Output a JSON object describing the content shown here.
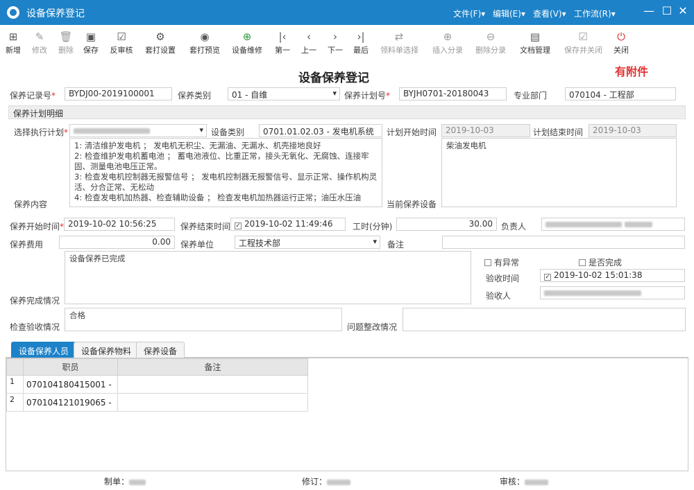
{
  "window": {
    "title": "设备保养登记",
    "menus": [
      "文件(F)▾",
      "编辑(E)▾",
      "查看(V)▾",
      "工作流(R)▾"
    ],
    "controls": [
      "—",
      "☐",
      "✕"
    ]
  },
  "toolbar": [
    {
      "label": "新增",
      "icon": "new-icon",
      "glyph": "⊞"
    },
    {
      "label": "修改",
      "icon": "edit-icon",
      "glyph": "✎"
    },
    {
      "label": "删除",
      "icon": "delete-icon",
      "glyph": "🗑"
    },
    {
      "label": "保存",
      "icon": "save-icon",
      "glyph": "▣"
    },
    {
      "label": "反审核",
      "icon": "unaudit-icon",
      "glyph": "☑"
    },
    {
      "label": "套打设置",
      "icon": "print-setup-icon",
      "glyph": "⚙"
    },
    {
      "label": "套打预览",
      "icon": "preview-icon",
      "glyph": "◉"
    },
    {
      "label": "设备维修",
      "icon": "repair-icon",
      "glyph": "⊕"
    },
    {
      "label": "第一",
      "icon": "first-icon",
      "glyph": "|‹"
    },
    {
      "label": "上一",
      "icon": "prev-icon",
      "glyph": "‹"
    },
    {
      "label": "下一",
      "icon": "next-icon",
      "glyph": "›"
    },
    {
      "label": "最后",
      "icon": "last-icon",
      "glyph": "›|"
    },
    {
      "label": "领料单选择",
      "icon": "refresh-icon",
      "glyph": "⇄"
    },
    {
      "label": "插入分录",
      "icon": "insert-row-icon",
      "glyph": "⊕"
    },
    {
      "label": "删除分录",
      "icon": "delete-row-icon",
      "glyph": "⊖"
    },
    {
      "label": "文档管理",
      "icon": "document-icon",
      "glyph": "▤"
    },
    {
      "label": "保存并关闭",
      "icon": "save-close-icon",
      "glyph": "☑"
    },
    {
      "label": "关闭",
      "icon": "power-icon",
      "glyph": "⏻"
    }
  ],
  "form": {
    "title": "设备保养登记",
    "attachment_notice": "有附件",
    "record_no": {
      "label": "保养记录号",
      "value": "BYDJ00-2019100001"
    },
    "category": {
      "label": "保养类别",
      "value": "01 - 自维"
    },
    "plan_no": {
      "label": "保养计划号",
      "value": "BYJH0701-20180043"
    },
    "department": {
      "label": "专业部门",
      "value": "070104 - 工程部"
    },
    "section_title": "保养计划明细",
    "exec_plan": {
      "label": "选择执行计划"
    },
    "equipment_type": {
      "label": "设备类别",
      "value": "0701.01.02.03 - 发电机系统"
    },
    "plan_start": {
      "label": "计划开始时间",
      "value": "2019-10-03"
    },
    "plan_end": {
      "label": "计划结束时间",
      "value": "2019-10-03"
    },
    "content": {
      "label": "保养内容",
      "lines": [
        "1: 清洁维护发电机 ；  发电机无积尘、无漏油、无漏水、机壳接地良好",
        "2: 检查维护发电机蓄电池 ；  蓄电池液位、比重正常，接头无氧化、无腐蚀、连接牢固、测量电池电压正常。",
        "3: 检查发电机控制器无报警信号 ；  发电机控制器无报警信号、显示正常、操作机构灵活、分合正常、无松动",
        "4: 检查发电机加热器、检查辅助设备 ；  检查发电机加热器运行正常；油压水压油"
      ]
    },
    "current_equipment": {
      "label": "当前保养设备",
      "value": "柴油发电机"
    },
    "start_time": {
      "label": "保养开始时间",
      "value": "2019-10-02 10:56:25"
    },
    "end_time": {
      "label": "保养结束时间",
      "value": "2019-10-02 11:49:46"
    },
    "work_hours": {
      "label": "工时(分钟)",
      "value": "30.00"
    },
    "owner": {
      "label": "负责人"
    },
    "cost": {
      "label": "保养费用",
      "value": "0.00"
    },
    "unit": {
      "label": "保养单位",
      "value": "工程技术部"
    },
    "remark": {
      "label": "备注",
      "value": ""
    },
    "completion": {
      "label": "保养完成情况",
      "value": "设备保养已完成"
    },
    "abnormal": {
      "label": "有异常"
    },
    "done": {
      "label": "是否完成"
    },
    "accept_time": {
      "label": "验收时间",
      "value": "2019-10-02 15:01:38"
    },
    "acceptor": {
      "label": "验收人"
    },
    "inspection": {
      "label": "检查验收情况",
      "value": "合格"
    },
    "rectify": {
      "label": "问题整改情况",
      "value": ""
    }
  },
  "tabs": [
    "设备保养人员",
    "设备保养物料",
    "保养设备"
  ],
  "grid": {
    "headers": [
      "职员",
      "备注"
    ],
    "rows": [
      {
        "no": "1",
        "staff": "070104180415001 -",
        "note": ""
      },
      {
        "no": "2",
        "staff": "070104121019065 -",
        "note": ""
      }
    ]
  },
  "footer": {
    "maker": "制单：",
    "reviser": "修订：",
    "auditor": "审核："
  }
}
